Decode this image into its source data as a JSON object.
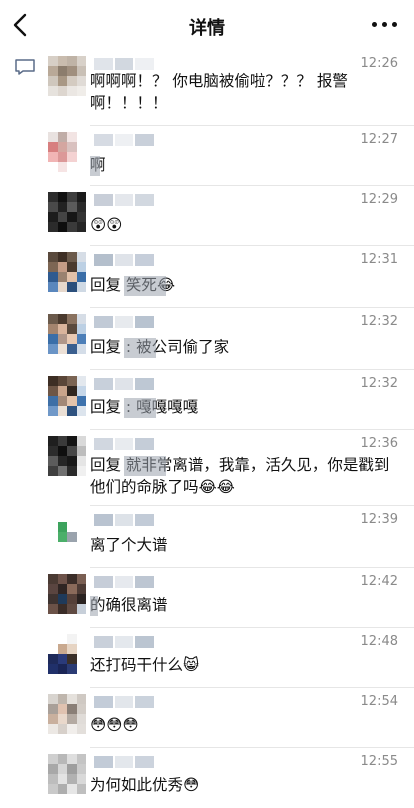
{
  "header": {
    "title": "详情"
  },
  "comments": [
    {
      "time": "12:26",
      "text": "啊啊啊！？ 你电脑被偷啦？？？ 报警啊！！！！"
    },
    {
      "time": "12:27",
      "text": "啊"
    },
    {
      "time": "12:29",
      "text": "😲😲"
    },
    {
      "time": "12:31",
      "text": "回复       笑死😂"
    },
    {
      "time": "12:32",
      "text": "回复      : 被公司偷了家"
    },
    {
      "time": "12:32",
      "text": "回复      : 嘎嘎嘎嘎"
    },
    {
      "time": "12:36",
      "text": "回复       就非常离谱，我靠，活久见，你是戳到他们的命脉了吗😂😂"
    },
    {
      "time": "12:39",
      "text": "离了个大谱"
    },
    {
      "time": "12:42",
      "text": "的确很离谱"
    },
    {
      "time": "12:48",
      "text": "还打码干什么😸"
    },
    {
      "time": "12:54",
      "text": "😳😳😳"
    },
    {
      "time": "12:55",
      "text": "为何如此优秀😳"
    }
  ]
}
